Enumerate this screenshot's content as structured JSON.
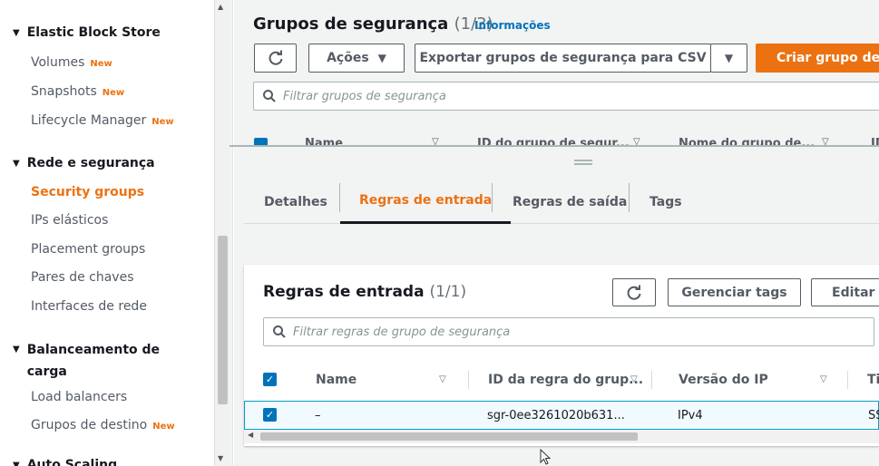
{
  "sidebar": {
    "sections": [
      {
        "label": "Elastic Block Store",
        "items": [
          {
            "label": "Volumes",
            "badge": "New"
          },
          {
            "label": "Snapshots",
            "badge": "New"
          },
          {
            "label": "Lifecycle Manager",
            "badge": "New"
          }
        ]
      },
      {
        "label": "Rede e segurança",
        "items": [
          {
            "label": "Security groups",
            "badge": ""
          },
          {
            "label": "IPs elásticos",
            "badge": ""
          },
          {
            "label": "Placement groups",
            "badge": ""
          },
          {
            "label": "Pares de chaves",
            "badge": ""
          },
          {
            "label": "Interfaces de rede",
            "badge": ""
          }
        ]
      },
      {
        "label": "Balanceamento de carga",
        "items": [
          {
            "label": "Load balancers",
            "badge": ""
          },
          {
            "label": "Grupos de destino",
            "badge": "New"
          }
        ]
      },
      {
        "label": "Auto Scaling",
        "items": []
      }
    ],
    "active_item": "Security groups"
  },
  "top": {
    "title": "Grupos de segurança",
    "count": "(1/3)",
    "info_link": "Informações",
    "refresh_icon": "refresh-icon",
    "actions_label": "Ações",
    "export_label": "Exportar grupos de segurança para CSV",
    "create_label": "Criar grupo de s",
    "search_placeholder": "Filtrar grupos de segurança",
    "table_headers": [
      "Name",
      "ID do grupo de segur...",
      "Nome do grupo de...",
      "ID"
    ]
  },
  "tabs": [
    {
      "label": "Detalhes",
      "active": false
    },
    {
      "label": "Regras de entrada",
      "active": true
    },
    {
      "label": "Regras de saída",
      "active": false
    },
    {
      "label": "Tags",
      "active": false
    }
  ],
  "inbound": {
    "title": "Regras de entrada",
    "count": "(1/1)",
    "manage_tags_label": "Gerenciar tags",
    "edit_label": "Editar r",
    "search_placeholder": "Filtrar regras de grupo de segurança",
    "headers": [
      "Name",
      "ID da regra do grup...",
      "Versão do IP",
      "Ti"
    ],
    "rows": [
      {
        "name": "–",
        "rule_id": "sgr-0ee3261020b631...",
        "ip_version": "IPv4",
        "type": "SS"
      }
    ]
  },
  "colors": {
    "accent": "#ec7211",
    "link": "#0073bb",
    "checkbox": "#0073bb"
  }
}
